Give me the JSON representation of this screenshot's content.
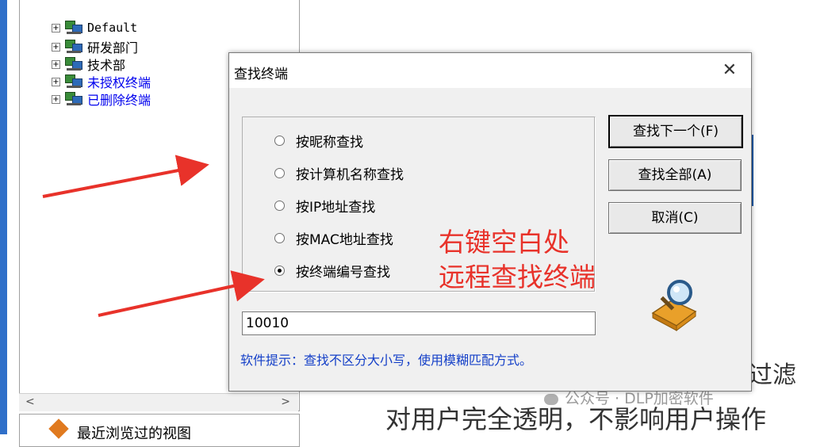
{
  "tree": {
    "cut_top_label": "",
    "items": [
      {
        "expander": "+",
        "label": "Default",
        "color": "#000000"
      },
      {
        "expander": "+",
        "label": "研发部门",
        "color": "#000000"
      },
      {
        "expander": "+",
        "label": "技术部",
        "color": "#000000"
      },
      {
        "expander": "+",
        "label": "未授权终端",
        "color": "#0000ee"
      },
      {
        "expander": "+",
        "label": "已删除终端",
        "color": "#0000ee"
      }
    ],
    "scroll_left": "<",
    "scroll_right": ">",
    "bottom_panel_label": "最近浏览过的视图"
  },
  "dialog": {
    "title": "查找终端",
    "close_glyph": "✕",
    "options": [
      {
        "label": "按昵称查找",
        "checked": false
      },
      {
        "label": "按计算机名称查找",
        "checked": false
      },
      {
        "label": "按IP地址查找",
        "checked": false
      },
      {
        "label": "按MAC地址查找",
        "checked": false
      },
      {
        "label": "按终端编号查找",
        "checked": true
      }
    ],
    "buttons": {
      "find_next": "查找下一个(F)",
      "find_all": "查找全部(A)",
      "cancel": "取消(C)"
    },
    "search_value": "10010",
    "hint": "软件提示：查找不区分大小写，使用模糊匹配方式。"
  },
  "annotation": {
    "line1": "右键空白处",
    "line2": "远程查找终端",
    "color": "#e8322a"
  },
  "background": {
    "text_right_partial": "过滤",
    "text_bottom": "对用户完全透明，不影响用户操作",
    "watermark": "公众号 · DLP加密软件"
  },
  "icons": {
    "expander": "plus-box-icon",
    "computer": "computer-group-icon",
    "find": "magnifier-icon",
    "arrow": "red-arrow-icon"
  }
}
